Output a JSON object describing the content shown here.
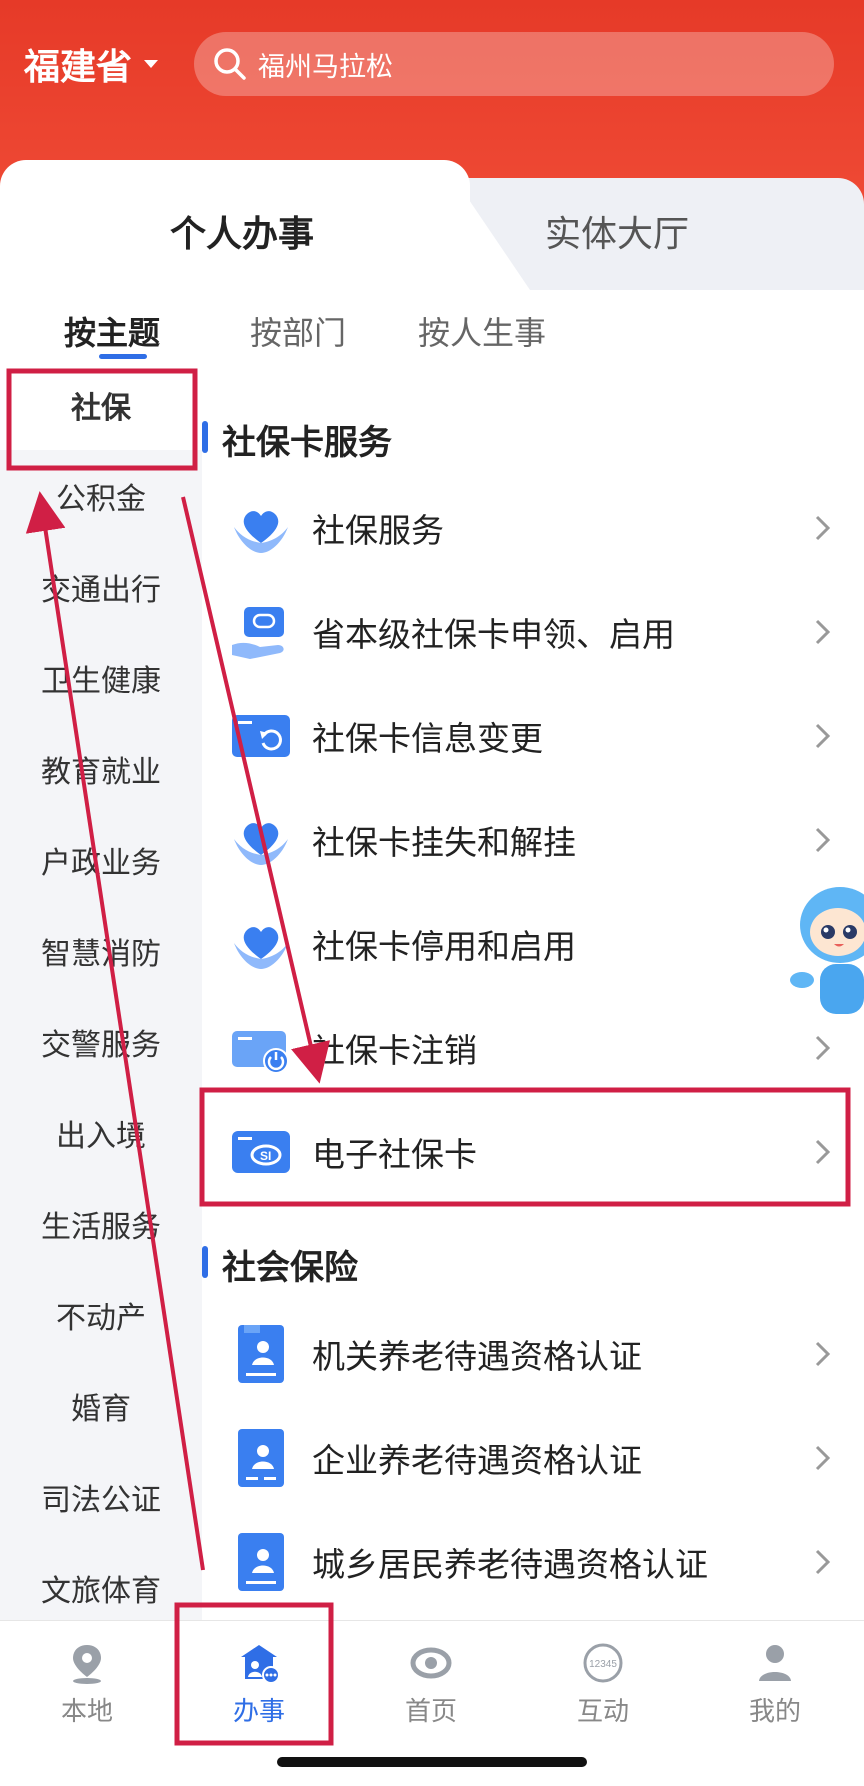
{
  "header": {
    "province": "福建省",
    "search_placeholder": "福州马拉松"
  },
  "tabs": [
    {
      "label": "个人办事",
      "active": true
    },
    {
      "label": "实体大厅",
      "active": false
    }
  ],
  "subtabs": [
    {
      "label": "按主题",
      "active": true
    },
    {
      "label": "按部门",
      "active": false
    },
    {
      "label": "按人生事",
      "active": false
    }
  ],
  "sidebar": {
    "items": [
      {
        "label": "社保",
        "active": true
      },
      {
        "label": "公积金"
      },
      {
        "label": "交通出行"
      },
      {
        "label": "卫生健康"
      },
      {
        "label": "教育就业"
      },
      {
        "label": "户政业务"
      },
      {
        "label": "智慧消防"
      },
      {
        "label": "交警服务"
      },
      {
        "label": "出入境"
      },
      {
        "label": "生活服务"
      },
      {
        "label": "不动产"
      },
      {
        "label": "婚育"
      },
      {
        "label": "司法公证"
      },
      {
        "label": "文旅体育"
      }
    ]
  },
  "sections": [
    {
      "title": "社保卡服务",
      "items": [
        {
          "label": "社保服务",
          "icon": "heart-hands-icon"
        },
        {
          "label": "省本级社保卡申领、启用",
          "icon": "card-in-hand-icon"
        },
        {
          "label": "社保卡信息变更",
          "icon": "card-refresh-icon"
        },
        {
          "label": "社保卡挂失和解挂",
          "icon": "heart-hands-icon"
        },
        {
          "label": "社保卡停用和启用",
          "icon": "heart-hands-icon"
        },
        {
          "label": "社保卡注销",
          "icon": "card-power-icon"
        },
        {
          "label": "电子社保卡",
          "icon": "e-card-icon"
        }
      ]
    },
    {
      "title": "社会保险",
      "items": [
        {
          "label": "机关养老待遇资格认证",
          "icon": "profile-book-icon"
        },
        {
          "label": "企业养老待遇资格认证",
          "icon": "profile-book-icon"
        },
        {
          "label": "城乡居民养老待遇资格认证",
          "icon": "profile-book-icon"
        }
      ]
    }
  ],
  "bottom_nav": [
    {
      "label": "本地",
      "icon": "location-pin-icon",
      "active": false
    },
    {
      "label": "办事",
      "icon": "service-hall-icon",
      "active": true
    },
    {
      "label": "首页",
      "icon": "home-logo-icon",
      "active": false
    },
    {
      "label": "互动",
      "icon": "hotline-12345-icon",
      "active": false,
      "icon_text": "12345"
    },
    {
      "label": "我的",
      "icon": "user-icon",
      "active": false
    }
  ],
  "colors": {
    "header_red": "#e63a28",
    "accent_blue": "#2f6ee6",
    "icon_blue": "#3a7ff0",
    "annotation_red": "#d01f45"
  }
}
